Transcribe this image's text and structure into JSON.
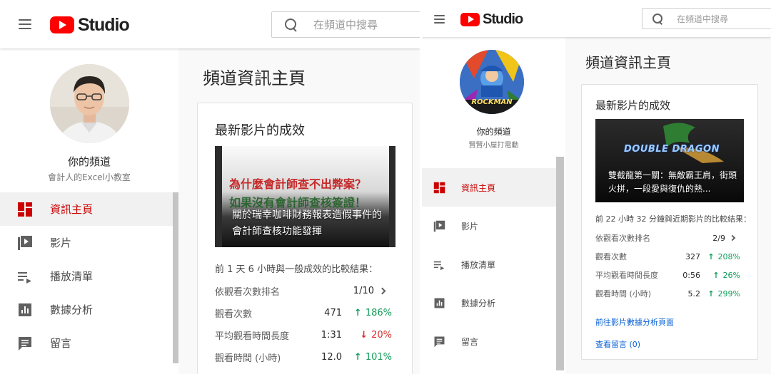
{
  "accent": "#cc0000",
  "positive_color": "#0f9d58",
  "negative_color": "#d32f2f",
  "link_color": "#065fd4",
  "panels": [
    {
      "logo_text": "Studio",
      "search_placeholder": "在頻道中搜尋",
      "channel_title": "你的頻道",
      "channel_sub": "會計人的Excel小教室",
      "nav": [
        {
          "label": "資訊主頁",
          "icon": "dashboard-icon",
          "active": true
        },
        {
          "label": "影片",
          "icon": "video-icon"
        },
        {
          "label": "播放清單",
          "icon": "playlist-icon"
        },
        {
          "label": "數據分析",
          "icon": "analytics-icon"
        },
        {
          "label": "留言",
          "icon": "comment-icon"
        }
      ],
      "page_title": "頻道資訊主頁",
      "card_title": "最新影片的成效",
      "thumb_banner_1": "為什麼會計師查不出弊案？",
      "thumb_banner_2": "如果沒有會計師查核簽證！",
      "video_title": "關於瑞幸咖啡財務報表造假事件的會計師查核功能發揮",
      "summary": "前 1 天 6 小時與一般成效的比較結果：",
      "rows": [
        {
          "label": "依觀看次數排名",
          "value": "1/10",
          "change": "",
          "dir": "chevron"
        },
        {
          "label": "觀看次數",
          "value": "471",
          "change": "186%",
          "dir": "up"
        },
        {
          "label": "平均觀看時間長度",
          "value": "1:31",
          "change": "20%",
          "dir": "down"
        },
        {
          "label": "觀看時間 (小時)",
          "value": "12.0",
          "change": "101%",
          "dir": "up"
        }
      ]
    },
    {
      "logo_text": "Studio",
      "search_placeholder": "在頻道中搜尋",
      "channel_title": "你的頻道",
      "channel_sub": "賢賢小屋打電動",
      "avatar_text": "ROCKMAN",
      "nav": [
        {
          "label": "資訊主頁",
          "icon": "dashboard-icon",
          "active": true
        },
        {
          "label": "影片",
          "icon": "video-icon"
        },
        {
          "label": "播放清單",
          "icon": "playlist-icon"
        },
        {
          "label": "數據分析",
          "icon": "analytics-icon"
        },
        {
          "label": "留言",
          "icon": "comment-icon"
        }
      ],
      "page_title": "頻道資訊主頁",
      "card_title": "最新影片的成效",
      "thumb_banner_1": "DOUBLE DRAGON",
      "video_title": "雙截龍第一關：無敵霸王肩，街頭火拼，一段愛與復仇的熱...",
      "summary": "前 22 小時 32 分鐘與近期影片的比較結果：",
      "rows": [
        {
          "label": "依觀看次數排名",
          "value": "2/9",
          "change": "",
          "dir": "chevron"
        },
        {
          "label": "觀看次數",
          "value": "327",
          "change": "208%",
          "dir": "up"
        },
        {
          "label": "平均觀看時間長度",
          "value": "0:56",
          "change": "26%",
          "dir": "up"
        },
        {
          "label": "觀看時間 (小時)",
          "value": "5.2",
          "change": "299%",
          "dir": "up"
        }
      ],
      "link_analytics": "前往影片數據分析頁面",
      "link_comments": "查看留言 (0)"
    }
  ]
}
